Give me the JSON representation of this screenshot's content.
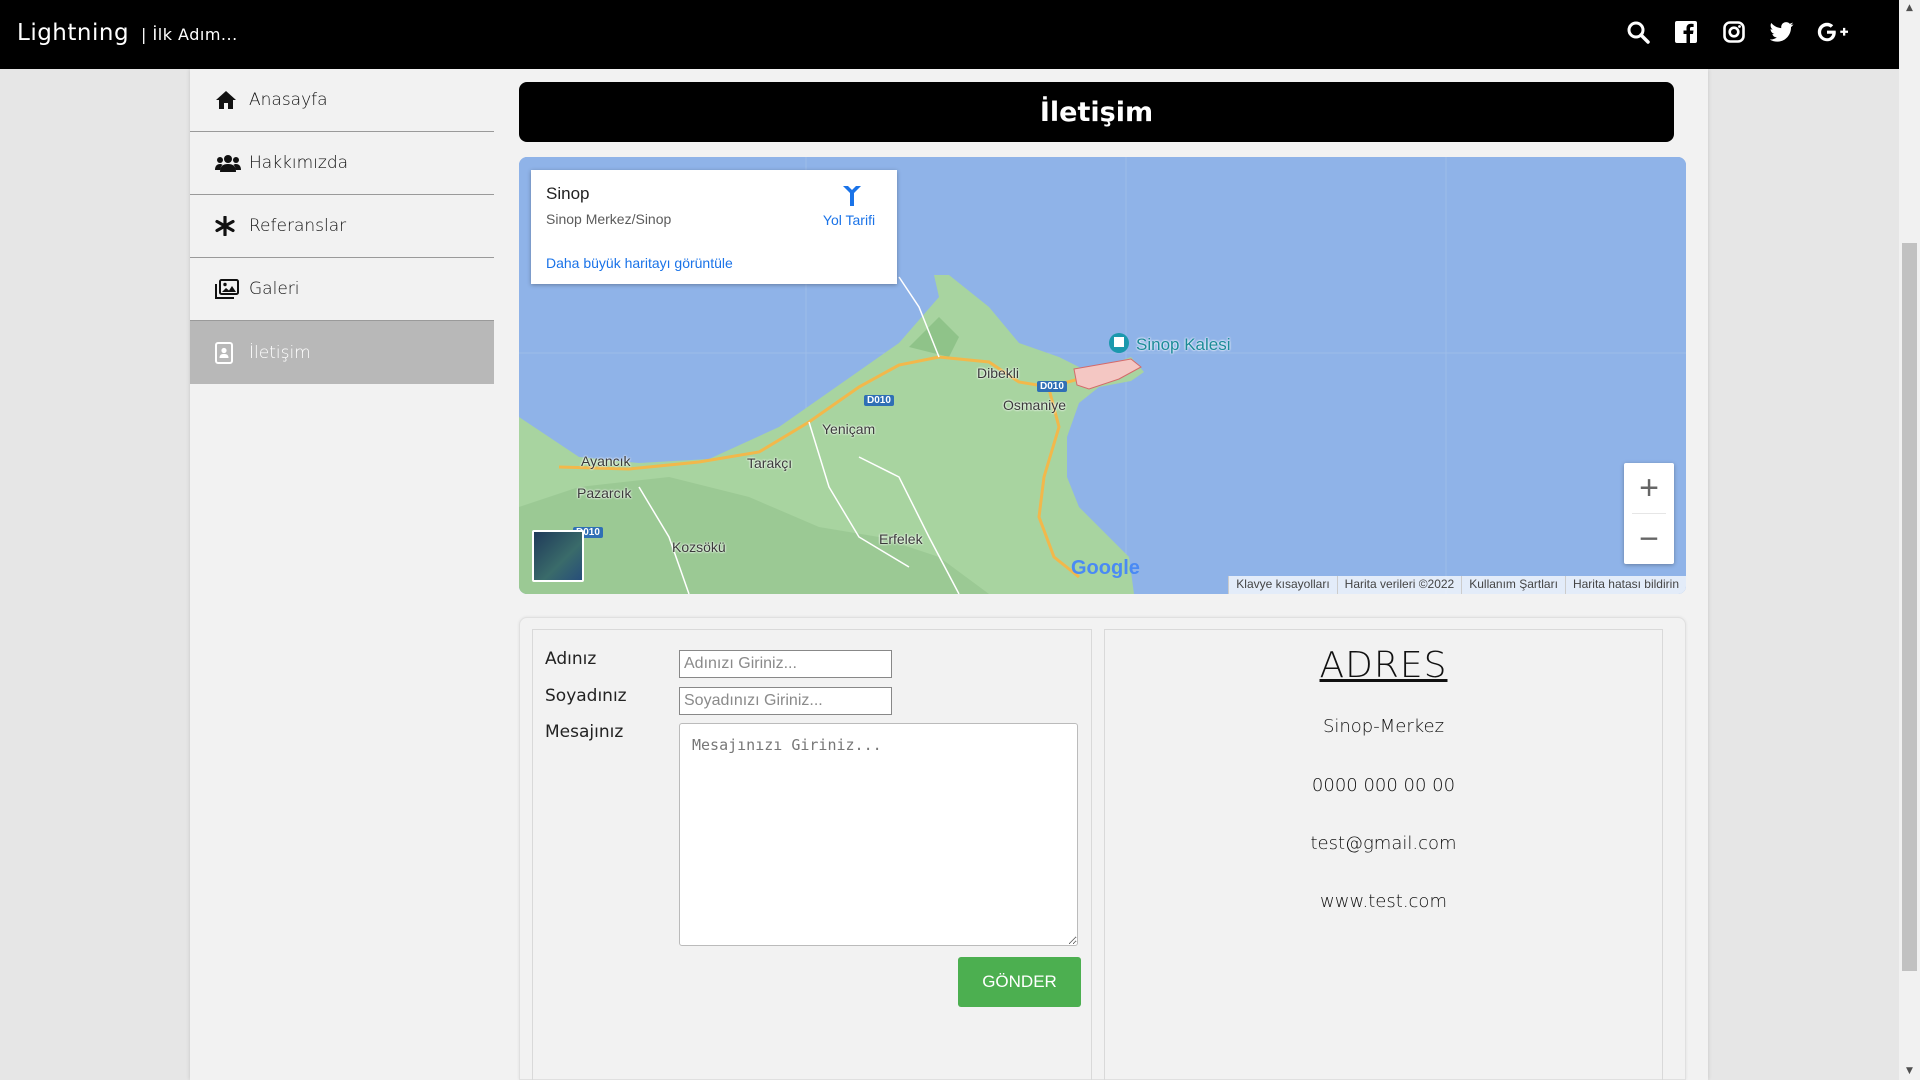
{
  "header": {
    "brand": "Lightning",
    "separator": "|",
    "slogan": "İlk Adım...",
    "icons": [
      "search-icon",
      "facebook-icon",
      "instagram-icon",
      "twitter-icon",
      "google-plus-icon"
    ]
  },
  "sidebar": {
    "items": [
      {
        "label": "Anasayfa",
        "icon": "home-icon"
      },
      {
        "label": "Hakkımızda",
        "icon": "users-icon"
      },
      {
        "label": "Referanslar",
        "icon": "asterisk-icon"
      },
      {
        "label": "Galeri",
        "icon": "images-icon"
      },
      {
        "label": "İletişim",
        "icon": "contact-card-icon",
        "active": true
      }
    ]
  },
  "page": {
    "title": "İletişim"
  },
  "map": {
    "place_name": "Sinop",
    "place_address": "Sinop Merkez/Sinop",
    "directions_label": "Yol Tarifi",
    "larger_map_link": "Daha büyük haritayı görüntüle",
    "poi": "Sinop Kalesi",
    "labels": [
      "Dibekli",
      "Osmaniye",
      "Yeniçam",
      "Ayancık",
      "Tarakçı",
      "Pazarcık",
      "Kozsökü",
      "Erfelek"
    ],
    "road_badges": [
      "D010",
      "D010",
      "D010"
    ],
    "zoom_in": "+",
    "zoom_out": "−",
    "google": "Google",
    "attribution": [
      "Klavye kısayolları",
      "Harita verileri ©2022",
      "Kullanım Şartları",
      "Harita hatası bildirin"
    ]
  },
  "form": {
    "name_label": "Adınız",
    "name_placeholder": "Adınızı Giriniz...",
    "surname_label": "Soyadınız",
    "surname_placeholder": "Soyadınızı Giriniz...",
    "message_label": "Mesajınız",
    "message_placeholder": "Mesajınızı Giriniz...",
    "submit_label": "GÖNDER"
  },
  "address": {
    "title": "ADRES",
    "location": "Sinop-Merkez",
    "phone": "0000 000 00 00",
    "email": "test@gmail.com",
    "website": "www.test.com"
  },
  "colors": {
    "topbar": "#000000",
    "active_nav": "#b8b8b8",
    "submit": "#4caf50",
    "link": "#1a73e8",
    "sea": "#8fb3e8",
    "land": "#a8d4a0"
  }
}
